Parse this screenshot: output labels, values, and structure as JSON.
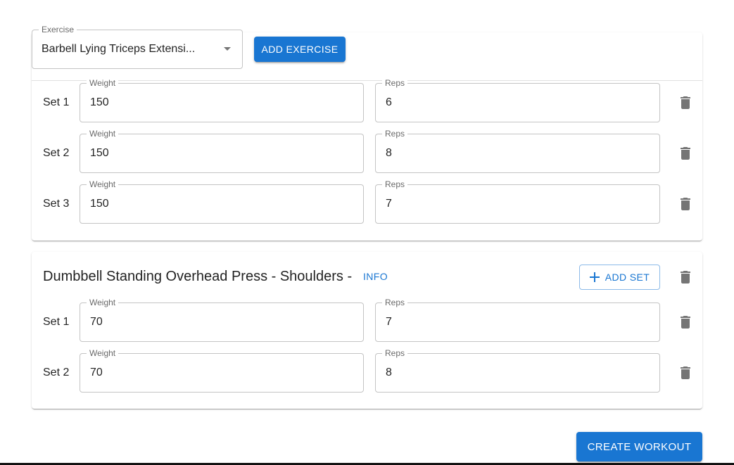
{
  "exercise_picker": {
    "label": "Exercise",
    "value": "Barbell Lying Triceps Extensi...",
    "add_button": "ADD EXERCISE"
  },
  "exercise1": {
    "sets": [
      {
        "label": "Set 1",
        "weight_label": "Weight",
        "weight": "150",
        "reps_label": "Reps",
        "reps": "6"
      },
      {
        "label": "Set 2",
        "weight_label": "Weight",
        "weight": "150",
        "reps_label": "Reps",
        "reps": "8"
      },
      {
        "label": "Set 3",
        "weight_label": "Weight",
        "weight": "150",
        "reps_label": "Reps",
        "reps": "7"
      }
    ]
  },
  "exercise2": {
    "title": "Dumbbell Standing Overhead Press - Shoulders -",
    "info_label": "INFO",
    "add_set_label": "ADD SET",
    "sets": [
      {
        "label": "Set 1",
        "weight_label": "Weight",
        "weight": "70",
        "reps_label": "Reps",
        "reps": "7"
      },
      {
        "label": "Set 2",
        "weight_label": "Weight",
        "weight": "70",
        "reps_label": "Reps",
        "reps": "8"
      }
    ]
  },
  "create_button": "CREATE WORKOUT",
  "colors": {
    "primary": "#1976d2",
    "icon": "#757575"
  },
  "icons": [
    "chevron-down-icon",
    "delete-icon",
    "plus-icon"
  ]
}
